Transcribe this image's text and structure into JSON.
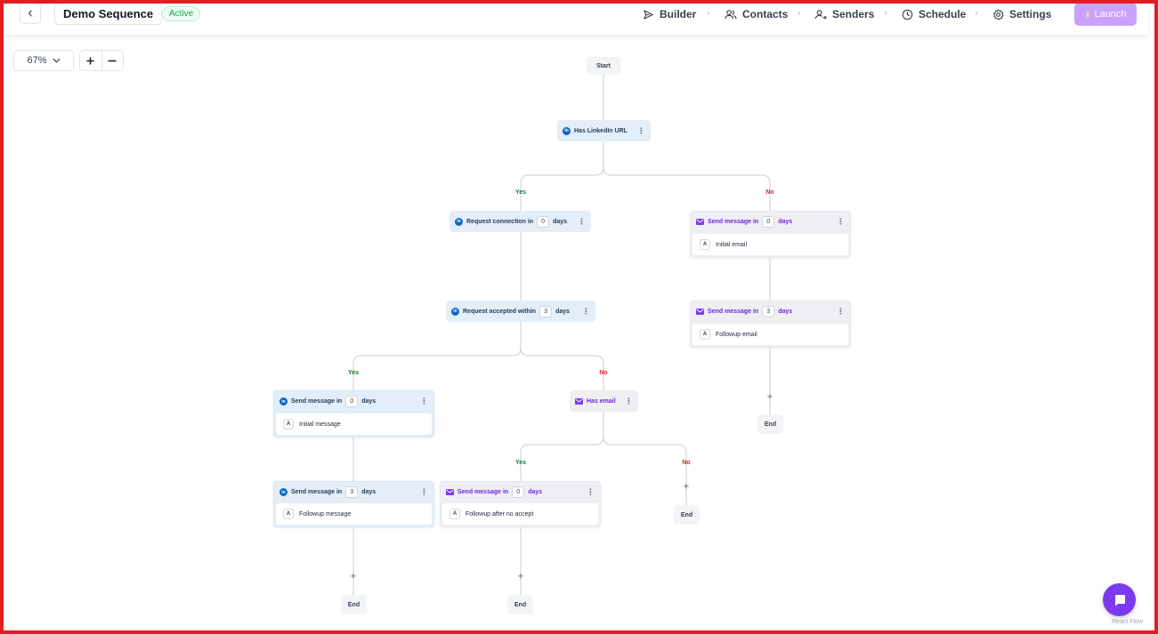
{
  "header": {
    "title": "Demo Sequence",
    "status": "Active",
    "nav": [
      "Builder",
      "Contacts",
      "Senders",
      "Schedule",
      "Settings"
    ],
    "launch_label": "Launch"
  },
  "zoom": {
    "level": "67%",
    "plus": "+",
    "minus": "—"
  },
  "flow": {
    "start": "Start",
    "end": "End",
    "yes": "Yes",
    "no": "No",
    "plus": "+",
    "has_linkedin_url": "Has LinkedIn URL",
    "request_connection": {
      "label": "Request connection in",
      "value": "0",
      "unit": "days"
    },
    "request_accepted": {
      "label": "Request accepted within",
      "value": "3",
      "unit": "days"
    },
    "has_email": "Has email",
    "send_label": "Send message in",
    "days": "days",
    "msg_initial_li": {
      "value": "0",
      "body": "Initial message"
    },
    "msg_followup_li": {
      "value": "3",
      "body": "Followup message"
    },
    "msg_followup_no_accept": {
      "value": "0",
      "body": "Followup after no accept"
    },
    "msg_initial_email": {
      "value": "0",
      "body": "Initial email"
    },
    "msg_followup_email": {
      "value": "3",
      "body": "Followup email"
    },
    "avatar_letter": "A",
    "linkedin_glyph": "in"
  },
  "footer": {
    "attribution": "React Flow"
  },
  "colors": {
    "frame": "#e11d22",
    "accent": "#7c3aed",
    "launch": "#c8a2fb",
    "linkedin": "#0a66c2",
    "yes": "#15803d",
    "no": "#dc2626"
  },
  "icons": [
    "chevron-left-icon",
    "send-icon",
    "users-icon",
    "user-send-icon",
    "clock-icon",
    "gear-icon",
    "chevron-right-icon",
    "chevron-down-icon",
    "linkedin-icon",
    "mail-icon",
    "kebab-icon",
    "chat-icon"
  ]
}
